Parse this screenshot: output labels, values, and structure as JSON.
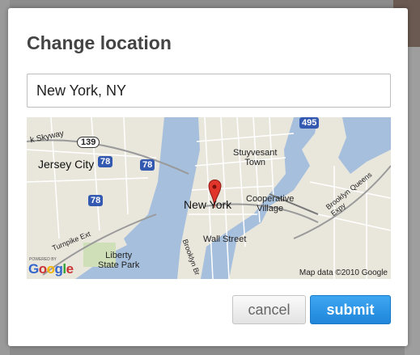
{
  "dialog": {
    "title": "Change location",
    "location_value": "New York, NY",
    "cancel_label": "cancel",
    "submit_label": "submit"
  },
  "map": {
    "labels": {
      "skyway": "k Skyway",
      "jersey_city": "Jersey City",
      "stuyvesant_town": "Stuyvesant\nTown",
      "new_york": "New York",
      "cooperative_village": "Cooperative\nVillage",
      "wall_street": "Wall Street",
      "brooklyn_queens": "Brooklyn Queens Expy",
      "liberty_state_park": "Liberty\nState Park",
      "turnpike": "Turnpike Ext",
      "brooklyn_br": "Brooklyn Br"
    },
    "shields": {
      "r139": "139",
      "i78a": "78",
      "i78b": "78",
      "i78c": "78",
      "i495": "495"
    },
    "powered_by": "POWERED BY",
    "google_logo": "Google",
    "attribution": "Map data ©2010 Google"
  },
  "colors": {
    "water": "#a5bfdd",
    "land": "#e9e6dc",
    "road_major": "#ffffff",
    "highway": "#f6d87a",
    "accent": "#1f86d9"
  }
}
